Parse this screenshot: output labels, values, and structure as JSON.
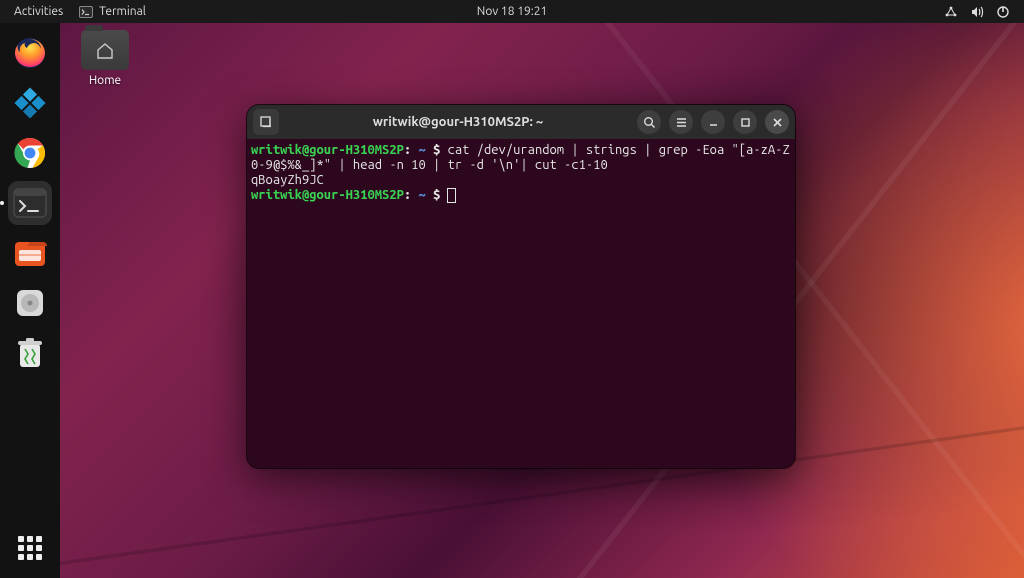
{
  "topbar": {
    "activities": "Activities",
    "app_menu": "Terminal",
    "clock": "Nov 18  19:21"
  },
  "desktop": {
    "home_label": "Home"
  },
  "dock": {
    "items": [
      {
        "name": "firefox"
      },
      {
        "name": "kodi"
      },
      {
        "name": "chrome"
      },
      {
        "name": "terminal"
      },
      {
        "name": "files"
      },
      {
        "name": "disks"
      },
      {
        "name": "trash"
      }
    ]
  },
  "terminal": {
    "title": "writwik@gour-H310MS2P: ~",
    "prompt": {
      "user_host": "writwik@gour-H310MS2P",
      "path": " ~"
    },
    "command": "cat /dev/urandom | strings | grep -Eoa \"[a-zA-Z0-9@$%&_]*\" | head -n 10 | tr -d '\\n'| cut -c1-10",
    "output": "qBoayZh9JC"
  }
}
